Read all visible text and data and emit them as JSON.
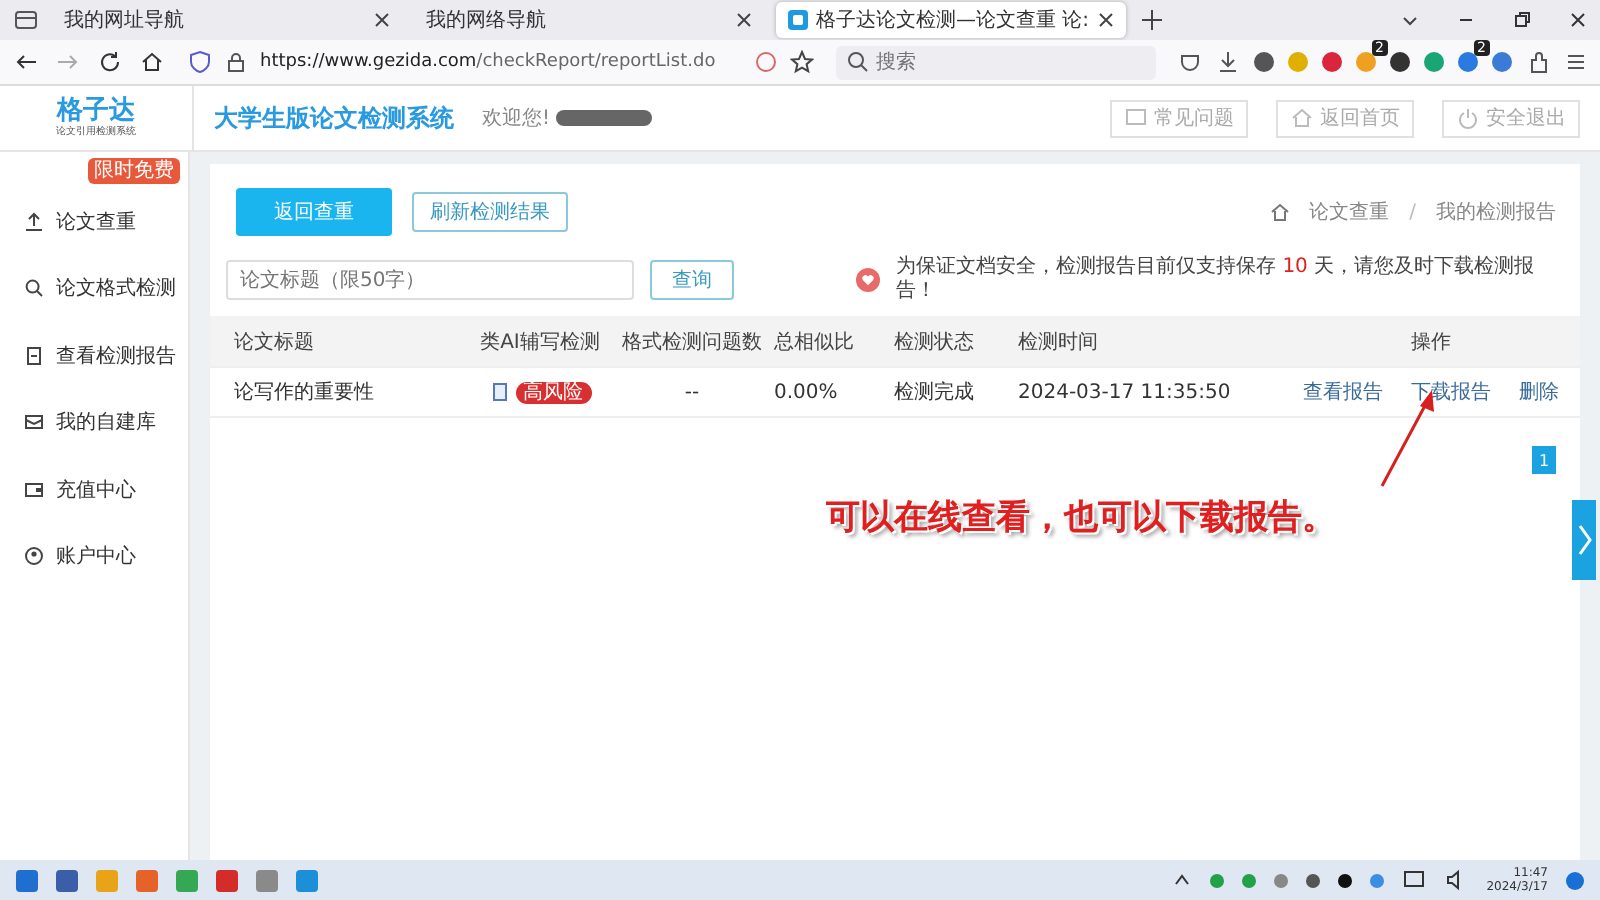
{
  "browser": {
    "tabs": [
      {
        "label": "我的网址导航",
        "selected": false
      },
      {
        "label": "我的网络导航",
        "selected": false
      },
      {
        "label": "格子达论文检测—论文查重 论:",
        "selected": true
      }
    ],
    "url_host": "https://www.gezida.com",
    "url_path": "/checkReport/reportList.do",
    "search": {
      "placeholder": "搜索"
    },
    "extension_badges": [
      "2",
      "2"
    ]
  },
  "header": {
    "logo": "格子达",
    "logo_tagline": "论文引用检测系统",
    "title": "大学生版论文检测系统",
    "welcome": "欢迎您!",
    "buttons": [
      "常见问题",
      "返回首页",
      "安全退出"
    ]
  },
  "sidebar": {
    "promo_badge": "限时免费",
    "items": [
      {
        "label": "论文查重"
      },
      {
        "label": "论文格式检测"
      },
      {
        "label": "查看检测报告"
      },
      {
        "label": "我的自建库"
      },
      {
        "label": "充值中心"
      },
      {
        "label": "账户中心"
      }
    ]
  },
  "content": {
    "primary_button": "返回查重",
    "refresh_button": "刷新检测结果",
    "breadcrumb": [
      "论文查重",
      "我的检测报告"
    ],
    "breadcrumb_separator": "/",
    "title_field": {
      "placeholder": "论文标题（限50字）"
    },
    "query_button": "查询",
    "notice": {
      "before": "为保证文档安全，检测报告目前仅支持保存 ",
      "days": "10",
      "after": " 天，请您及时下载检测报告！"
    },
    "table": {
      "columns": [
        "论文标题",
        "类AI辅写检测",
        "格式检测问题数",
        "总相似比",
        "检测状态",
        "检测时间",
        "操作"
      ],
      "rows": [
        {
          "title": "论写作的重要性",
          "ai_risk": "高风险",
          "format_issues": "--",
          "similarity": "0.00%",
          "status": "检测完成",
          "time": "2024-03-17 11:35:50",
          "actions": [
            "查看报告",
            "下载报告",
            "删除"
          ]
        }
      ]
    },
    "pages": [
      {
        "label": "1",
        "selected": true
      }
    ],
    "annotation": "可以在线查看，也可以下载报告。"
  },
  "taskbar": {
    "time": "11:47",
    "date": "2024/3/17"
  }
}
